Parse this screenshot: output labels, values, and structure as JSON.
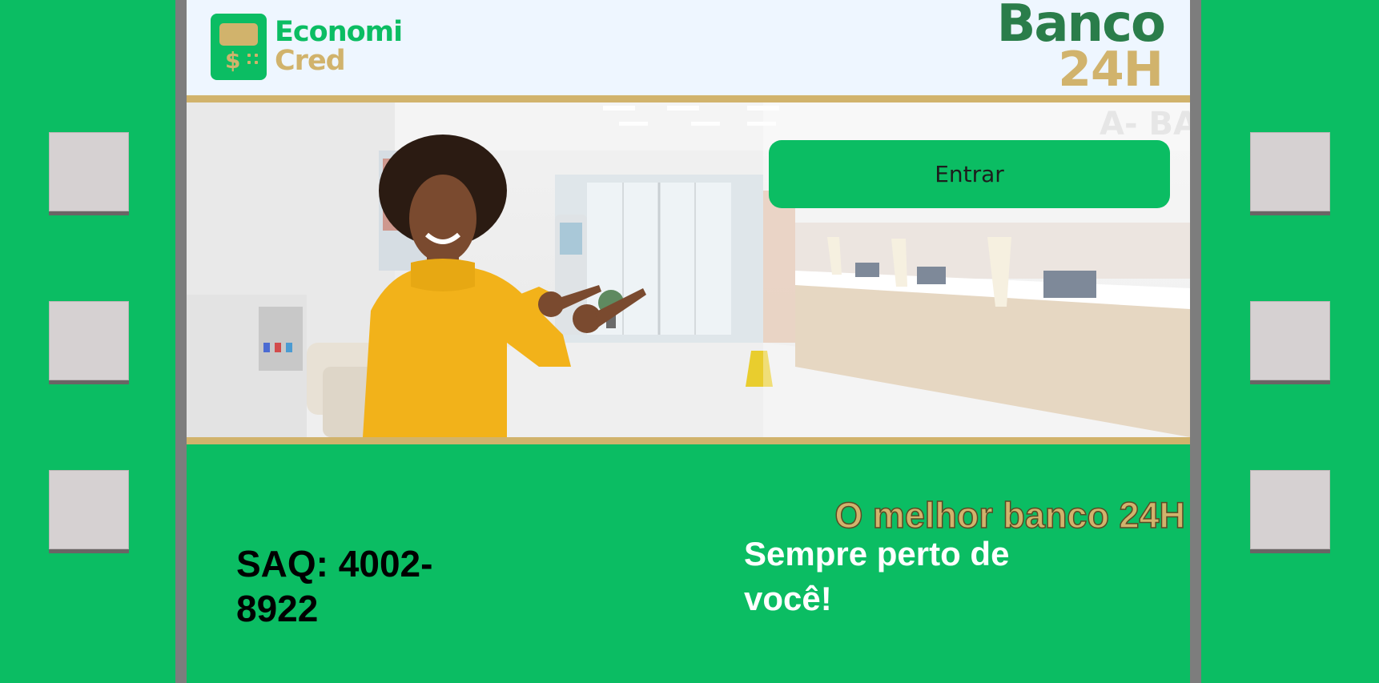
{
  "brand": {
    "logo_line1": "Economi",
    "logo_line2": "Cred",
    "logo_symbol": "$",
    "title_line1": "Banco",
    "title_line2": "24H"
  },
  "hero": {
    "enter_button_label": "Entrar"
  },
  "footer": {
    "saq_text": "SAQ: 4002-8922",
    "slogan": "O melhor banco 24H",
    "tagline": "Sempre perto de você!"
  },
  "colors": {
    "primary_green": "#0bbd63",
    "gold": "#d1b36c",
    "dark_green": "#2a7d4a",
    "header_bg": "#eef6ff"
  },
  "icons": {
    "logo": "atm-card-logo-icon"
  }
}
